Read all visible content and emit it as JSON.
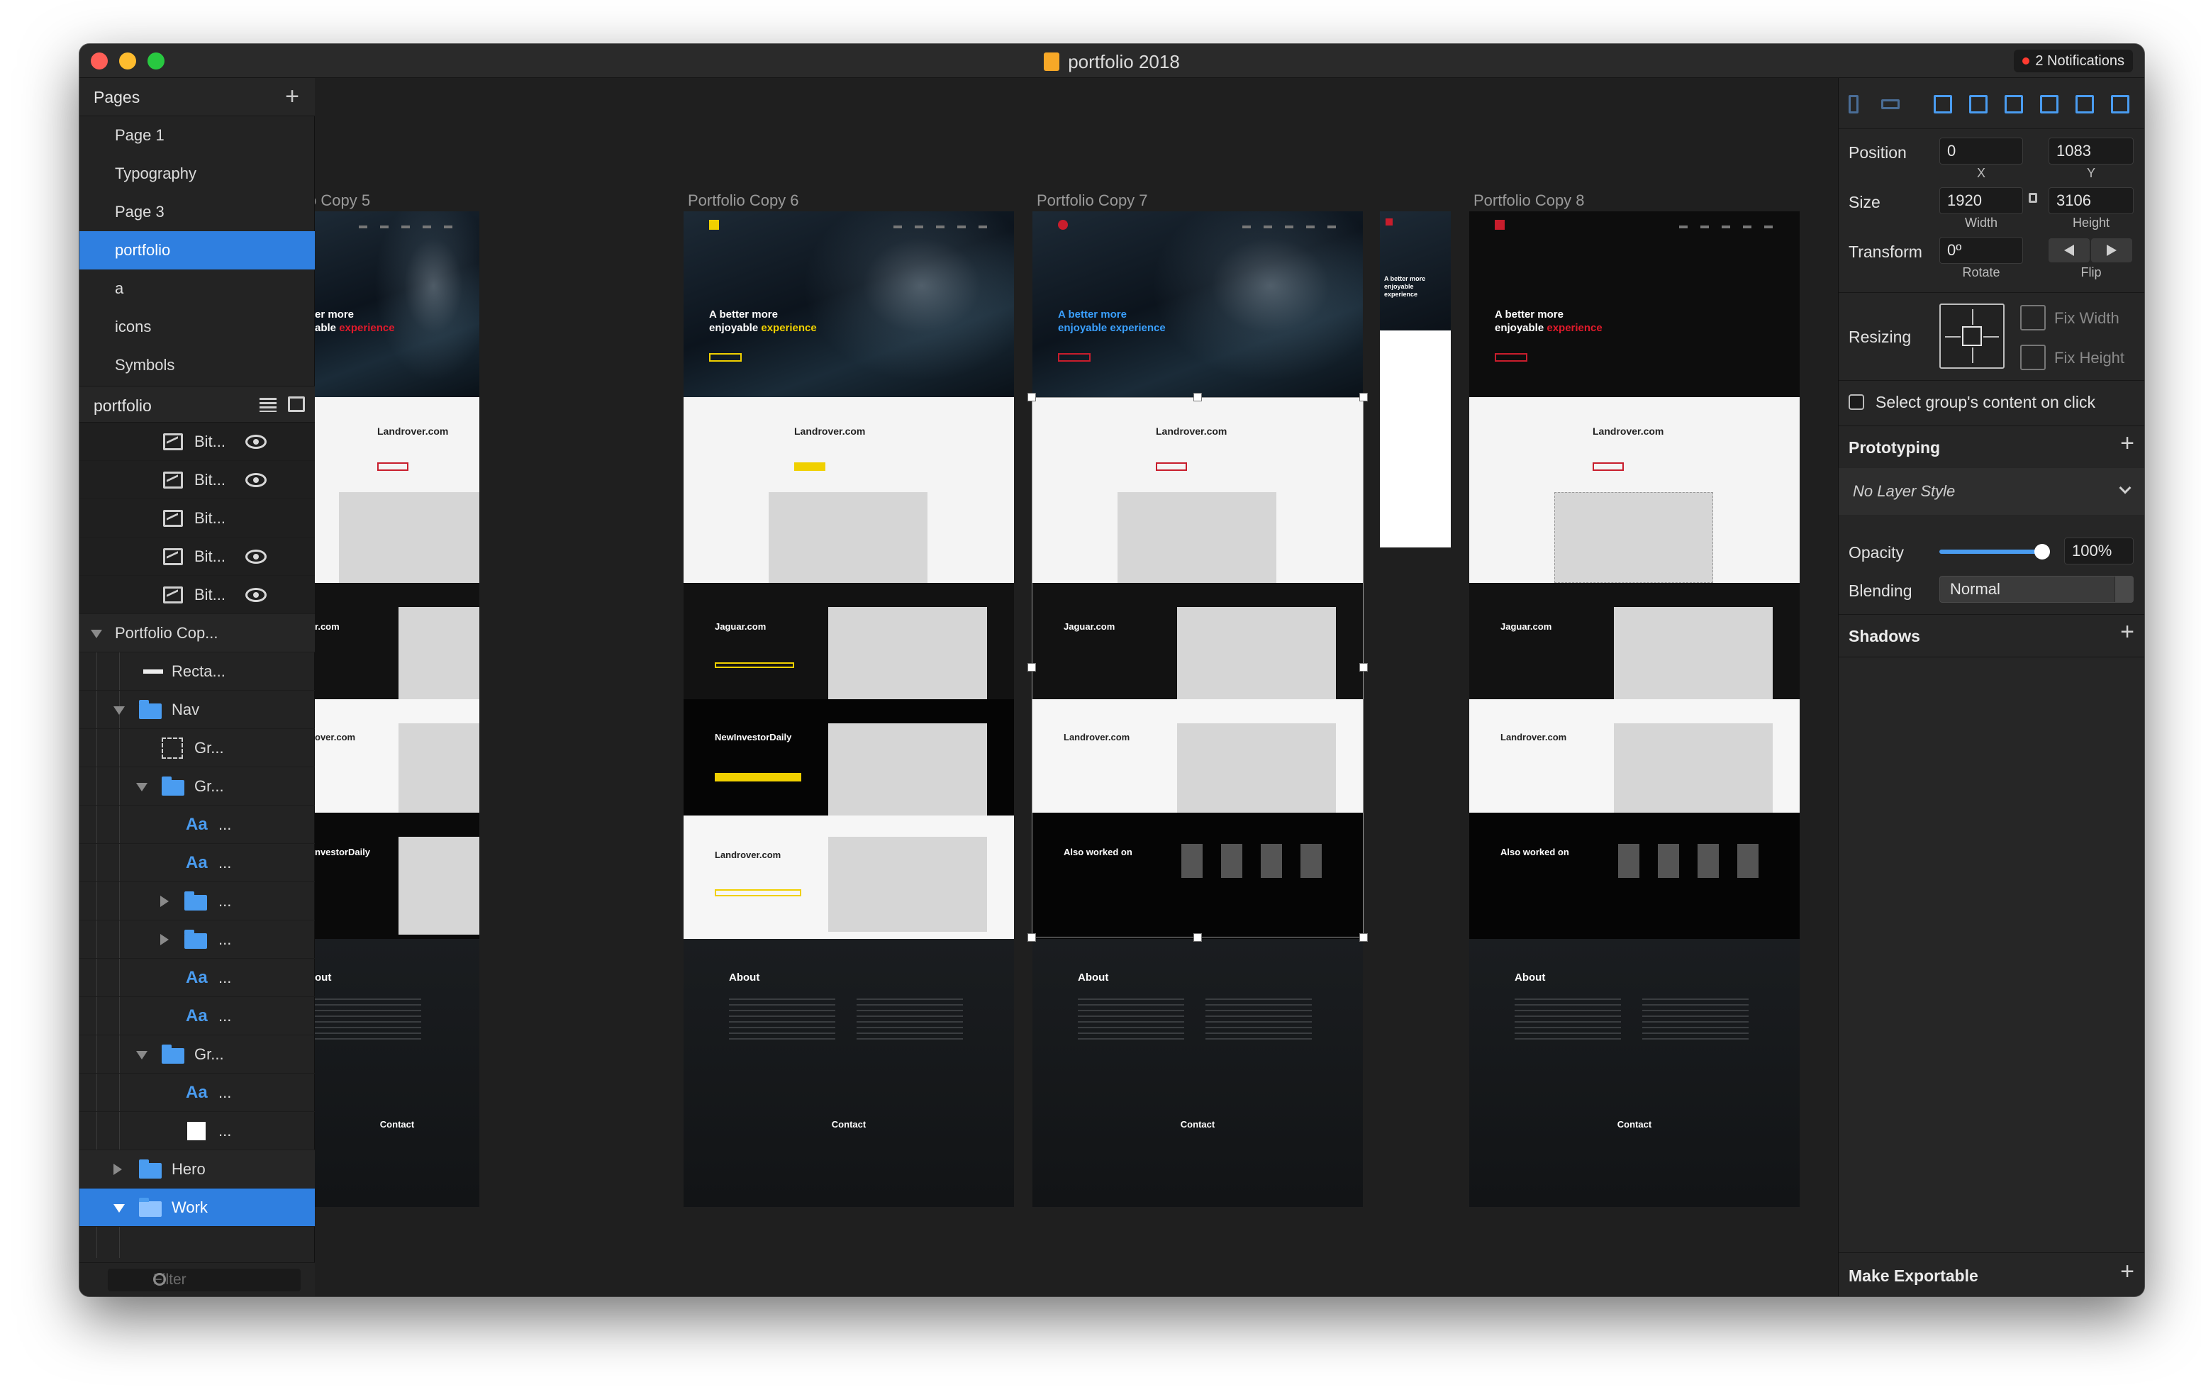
{
  "window": {
    "title": "portfolio 2018",
    "notifications": "2 Notifications"
  },
  "sidebar": {
    "pages_header": "Pages",
    "pages": [
      {
        "label": "Page 1"
      },
      {
        "label": "Typography"
      },
      {
        "label": "Page 3"
      },
      {
        "label": "portfolio",
        "selected": true
      },
      {
        "label": "a"
      },
      {
        "label": "icons"
      },
      {
        "label": "Symbols"
      }
    ],
    "layers_header": "portfolio",
    "layers": [
      {
        "label": "Bit...",
        "icon": "bitmap-icon",
        "eye": true
      },
      {
        "label": "Bit...",
        "icon": "bitmap-icon",
        "eye": true
      },
      {
        "label": "Bit...",
        "icon": "bitmap-icon",
        "eye": false
      },
      {
        "label": "Bit...",
        "icon": "bitmap-icon",
        "eye": true
      },
      {
        "label": "Bit...",
        "icon": "bitmap-icon",
        "eye": true
      },
      {
        "label": "Portfolio Cop...",
        "icon": "artboard-icon"
      },
      {
        "label": "Recta...",
        "icon": "rectangle-icon"
      },
      {
        "label": "Nav",
        "icon": "folder-icon"
      },
      {
        "label": "Gr...",
        "icon": "group-icon"
      },
      {
        "label": "Gr...",
        "icon": "folder-icon"
      },
      {
        "label": "...",
        "icon": "text-icon",
        "text": "Aa"
      },
      {
        "label": "...",
        "icon": "text-icon",
        "text": "Aa"
      },
      {
        "label": "...",
        "icon": "folder-icon"
      },
      {
        "label": "...",
        "icon": "folder-icon"
      },
      {
        "label": "...",
        "icon": "text-icon",
        "text": "Aa"
      },
      {
        "label": "...",
        "icon": "text-icon",
        "text": "Aa"
      },
      {
        "label": "Gr...",
        "icon": "folder-icon"
      },
      {
        "label": "...",
        "icon": "text-icon",
        "text": "Aa"
      },
      {
        "label": "...",
        "icon": "square-icon"
      },
      {
        "label": "Hero",
        "icon": "folder-icon"
      },
      {
        "label": "Work",
        "icon": "folder-icon",
        "selected": true
      }
    ],
    "filter_placeholder": "Filter"
  },
  "canvas": {
    "artboards": [
      {
        "label": "o Copy 5",
        "hero_line1": "er more",
        "hero_line2": "able ",
        "accent_word": "experience",
        "accent": "#e01a2b",
        "light_title": "Landrover.com",
        "dark1_title": "r.com",
        "white2_title": "over.com",
        "black_title": "nvestorDaily",
        "about": "out",
        "contact": "Contact"
      },
      {
        "label": "Portfolio Copy 6",
        "hero_line1": "A better more",
        "hero_line2": "enjoyable ",
        "accent_word": "experience",
        "accent": "#f0d000",
        "light_title": "Landrover.com",
        "dark1_title": "Jaguar.com",
        "white2_title": "NewInvestorDaily",
        "black_title": "Landrover.com",
        "about": "About",
        "contact": "Contact"
      },
      {
        "label": "Portfolio Copy 7",
        "hero_line1": "A better more",
        "hero_line2": "enjoyable ",
        "accent_word": "experience",
        "accent": "#3aa0ff",
        "light_title": "Landrover.com",
        "dark1_title": "Jaguar.com",
        "white2_title": "Landrover.com",
        "black_title": "Also worked on",
        "about": "About",
        "contact": "Contact"
      },
      {
        "label": "Portfolio Copy 8",
        "hero_line1": "A better more",
        "hero_line2": "enjoyable ",
        "accent_word": "experience",
        "accent": "#e01a2b",
        "light_title": "Landrover.com",
        "dark1_title": "Jaguar.com",
        "white2_title": "Landrover.com",
        "black_title": "Also worked on",
        "about": "About",
        "contact": "Contact"
      }
    ],
    "mini_artboard": {
      "line1": "A better more",
      "line2": "enjoyable experience"
    }
  },
  "inspector": {
    "position_label": "Position",
    "x_value": "0",
    "y_value": "1083",
    "x_caption": "X",
    "y_caption": "Y",
    "size_label": "Size",
    "width_value": "1920",
    "height_value": "3106",
    "width_caption": "Width",
    "height_caption": "Height",
    "transform_label": "Transform",
    "rotate_value": "0º",
    "rotate_caption": "Rotate",
    "flip_caption": "Flip",
    "resizing_label": "Resizing",
    "fix_width": "Fix Width",
    "fix_height": "Fix Height",
    "select_group_label": "Select group's content on click",
    "prototyping_label": "Prototyping",
    "layer_style": "No Layer Style",
    "opacity_label": "Opacity",
    "opacity_value": "100%",
    "opacity_level": 1.0,
    "blending_label": "Blending",
    "blending_value": "Normal",
    "shadows_label": "Shadows",
    "exportable_label": "Make Exportable"
  },
  "colors": {
    "selection_blue": "#2f7fe0",
    "icon_blue": "#4a9cf0",
    "brand_red": "#e01a2b",
    "brand_yellow": "#f0d000"
  }
}
